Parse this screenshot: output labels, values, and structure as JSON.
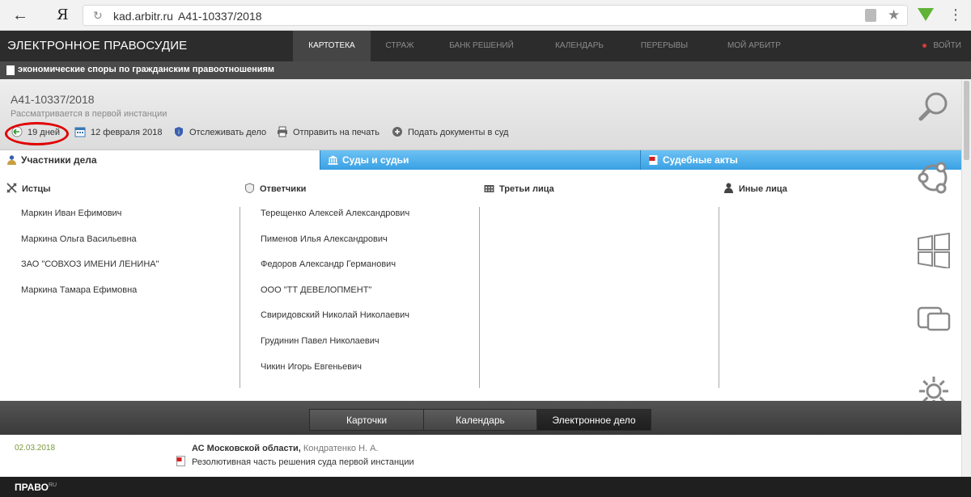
{
  "browser": {
    "logo": "Я",
    "url_domain": "kad.arbitr.ru",
    "url_case": "А41-10337/2018"
  },
  "topnav": {
    "brand": "ЭЛЕКТРОННОЕ ПРАВОСУДИЕ",
    "items": [
      "КАРТОТЕКА",
      "СТРАЖ",
      "БАНК РЕШЕНИЙ",
      "КАЛЕНДАРЬ",
      "ПЕРЕРЫВЫ",
      "МОЙ АРБИТР"
    ],
    "active": "КАРТОТЕКА",
    "login": "ВОЙТИ"
  },
  "category": {
    "text": "экономические споры по гражданским правоотношениям"
  },
  "case": {
    "number": "А41-10337/2018",
    "status": "Рассматривается в первой инстанции",
    "actions": {
      "days": "19 дней",
      "date": "12 февраля 2018",
      "track": "Отслеживать дело",
      "print": "Отправить на печать",
      "submit": "Подать документы в суд"
    }
  },
  "tabs": {
    "participants": "Участники дела",
    "courts": "Суды и судьи",
    "acts": "Судебные акты"
  },
  "participants": {
    "plaintiffs": {
      "title": "Истцы",
      "items": [
        "Маркин Иван Ефимович",
        "Маркина Ольга Васильевна",
        "ЗАО \"СОВХОЗ ИМЕНИ ЛЕНИНА\"",
        "Маркина Тамара Ефимовна"
      ]
    },
    "defendants": {
      "title": "Ответчики",
      "items": [
        "Терещенко Алексей Александрович",
        "Пименов Илья Александрович",
        "Федоров Александр Германович",
        "ООО \"ТТ ДЕВЕЛОПМЕНТ\"",
        "Свиридовский Николай Николаевич",
        "Грудинин Павел Николаевич",
        "Чикин Игорь Евгеньевич"
      ]
    },
    "third": {
      "title": "Третьи лица",
      "items": []
    },
    "other": {
      "title": "Иные лица",
      "items": []
    }
  },
  "bottom_tabs": {
    "cards": "Карточки",
    "calendar": "Календарь",
    "electronic": "Электронное дело",
    "active": "Электронное дело"
  },
  "document": {
    "date": "02.03.2018",
    "court": "АС Московской области,",
    "judge": "Кондратенко Н. А.",
    "title": "Резолютивная часть решения суда первой инстанции"
  },
  "footer": {
    "logo": "ПРАВО",
    "logo_sup": "RU"
  },
  "colors": {
    "tab_blue": "#3aa1e4",
    "nav_dark": "#2c2c2c",
    "highlight_red": "#e00000",
    "date_green": "#7a9a3b"
  }
}
